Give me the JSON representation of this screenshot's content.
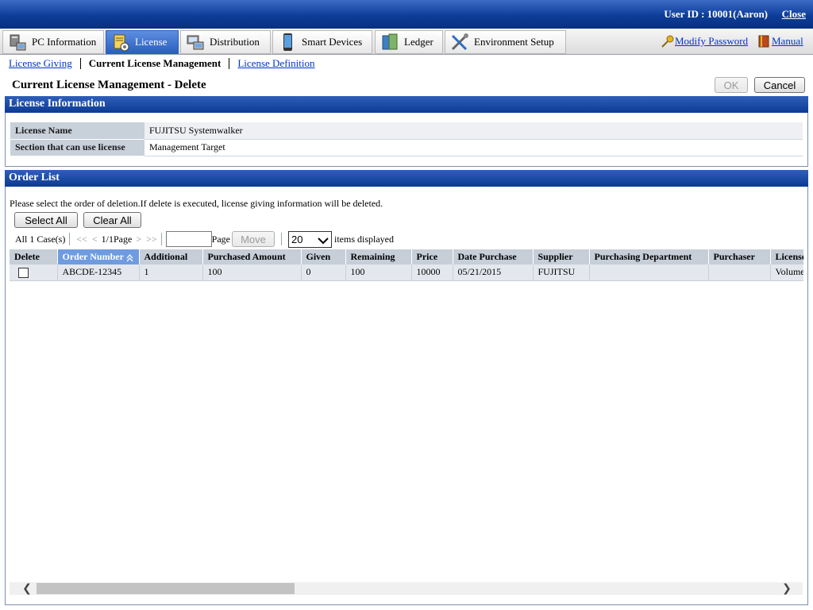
{
  "header": {
    "user_id": "User ID : 10001(Aaron)",
    "close_label": "Close"
  },
  "menu": [
    {
      "label": "PC Information",
      "icon": "pc-icon"
    },
    {
      "label": "License",
      "icon": "license-icon",
      "active": true
    },
    {
      "label": "Distribution",
      "icon": "distribution-icon"
    },
    {
      "label": "Smart Devices",
      "icon": "smartphone-icon"
    },
    {
      "label": "Ledger",
      "icon": "ledger-icon"
    },
    {
      "label": "Environment Setup",
      "icon": "tools-icon"
    }
  ],
  "menu_right": {
    "modify_password": "Modify Password",
    "manual": "Manual"
  },
  "subnav": {
    "license_giving": "License Giving",
    "current": "Current License Management",
    "license_definition": "License Definition"
  },
  "page": {
    "title": "Current License Management - Delete",
    "ok_label": "OK",
    "cancel_label": "Cancel"
  },
  "license_info": {
    "header": "License Information",
    "rows": [
      {
        "label": "License Name",
        "value": "FUJITSU Systemwalker"
      },
      {
        "label": "Section that can use license",
        "value": "Management Target"
      }
    ]
  },
  "order_list": {
    "header": "Order List",
    "description": "Please select the order of deletion.If delete is executed, license giving information will be deleted.",
    "select_all": "Select All",
    "clear_all": "Clear All",
    "pager": {
      "count": "All 1 Case(s)",
      "first": "<<",
      "prev": "<",
      "page_info": "1/1Page",
      "next": ">",
      "last": ">>",
      "page_label": "Page",
      "move_label": "Move",
      "items_value": "20",
      "items_label": "items displayed"
    },
    "columns": [
      "Delete",
      "Order Number",
      "Additional",
      "Purchased Amount",
      "Given",
      "Remaining",
      "Price",
      "Date Purchase",
      "Supplier",
      "Purchasing Department",
      "Purchaser",
      "License"
    ],
    "rows": [
      [
        "",
        "ABCDE-12345",
        "1",
        "100",
        "0",
        "100",
        "10000",
        "05/21/2015",
        "FUJITSU",
        "",
        "",
        "Volume"
      ]
    ]
  }
}
